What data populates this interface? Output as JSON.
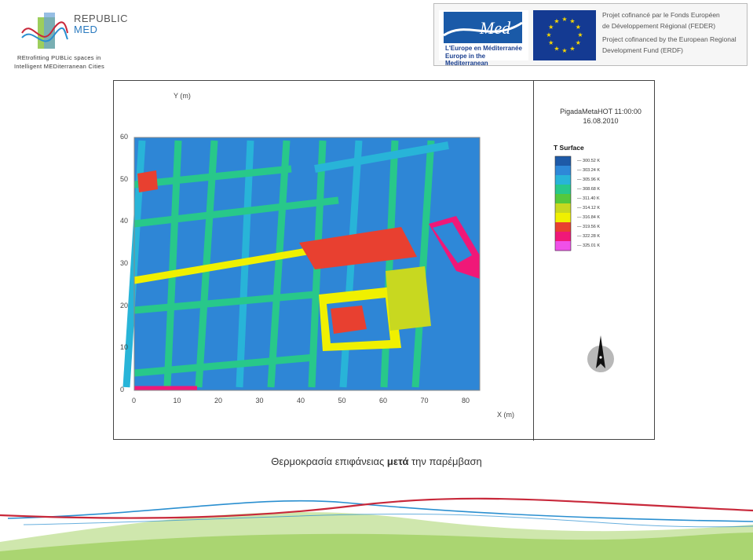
{
  "header": {
    "logo_left": {
      "brand_line1": "REPUBLIC",
      "brand_line2": "MED",
      "tagline_line1": "REtrofitting PUBLic spaces in",
      "tagline_line2": "Intelligent MEDiterranean Cities"
    },
    "banner": {
      "med_word": "Med",
      "med_line1": "L'Europe en Méditerranée",
      "med_line2": "Europe in the Mediterranean",
      "text_lines": [
        "Projet cofinancé par le Fonds Européen",
        "de Développement Régional (FEDER)",
        "Project cofinanced by the European Regional",
        "Development Fund (ERDF)"
      ]
    }
  },
  "figure": {
    "y_axis_label": "Y (m)",
    "x_axis_label": "X (m)",
    "y_ticks": [
      "60",
      "50",
      "40",
      "30",
      "20",
      "10",
      "0"
    ],
    "x_ticks": [
      "0",
      "10",
      "20",
      "30",
      "40",
      "50",
      "60",
      "70",
      "80"
    ],
    "legend_title_line1": "PigadaMetaHOT 11:00:00",
    "legend_title_line2": "16.08.2010",
    "legend_heading": "T Surface",
    "legend_values": [
      "300.52 K",
      "303.24 K",
      "305.96 K",
      "308.68 K",
      "311.40 K",
      "314.12 K",
      "316.84 K",
      "319.56 K",
      "322.28 K",
      "325.01 K"
    ],
    "legend_colors": [
      "#1e5aa8",
      "#2e88d8",
      "#28b4d8",
      "#28c88a",
      "#55c83c",
      "#c8d820",
      "#f0f000",
      "#e84030",
      "#f01878",
      "#f050e8"
    ]
  },
  "caption": {
    "prefix": "Θερμοκρασία επιφάνειας ",
    "bold": "μετά",
    "suffix": " την παρέμβαση"
  },
  "colors": {
    "eu_blue": "#143a92",
    "eu_star": "#f8d800",
    "wave_blue": "#2a8fd0",
    "wave_red": "#c8283a",
    "wave_green": "#9ccf5a"
  }
}
